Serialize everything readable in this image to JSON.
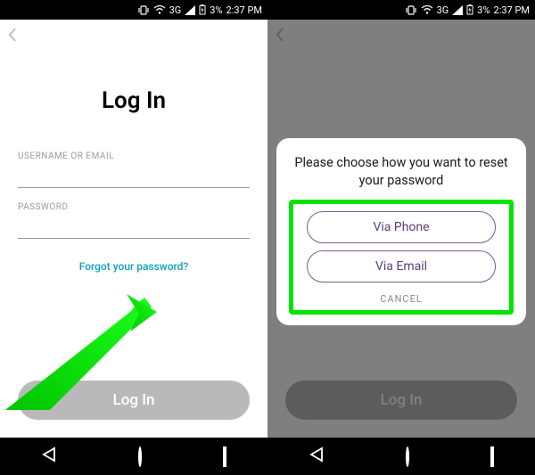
{
  "statusbar": {
    "network_label": "3G",
    "battery_text": "3%",
    "time": "2:37 PM"
  },
  "left": {
    "title": "Log In",
    "username_label": "USERNAME OR EMAIL",
    "username_value": "",
    "password_label": "PASSWORD",
    "password_value": "",
    "forgot_text": "Forgot your password?",
    "login_button": "Log In"
  },
  "modal": {
    "prompt": "Please choose how you want to reset your password",
    "option_phone": "Via Phone",
    "option_email": "Via Email",
    "cancel": "CANCEL"
  },
  "colors": {
    "highlight": "#00E500",
    "accent_link": "#0aa3b8",
    "option_text": "#5a3f77"
  }
}
